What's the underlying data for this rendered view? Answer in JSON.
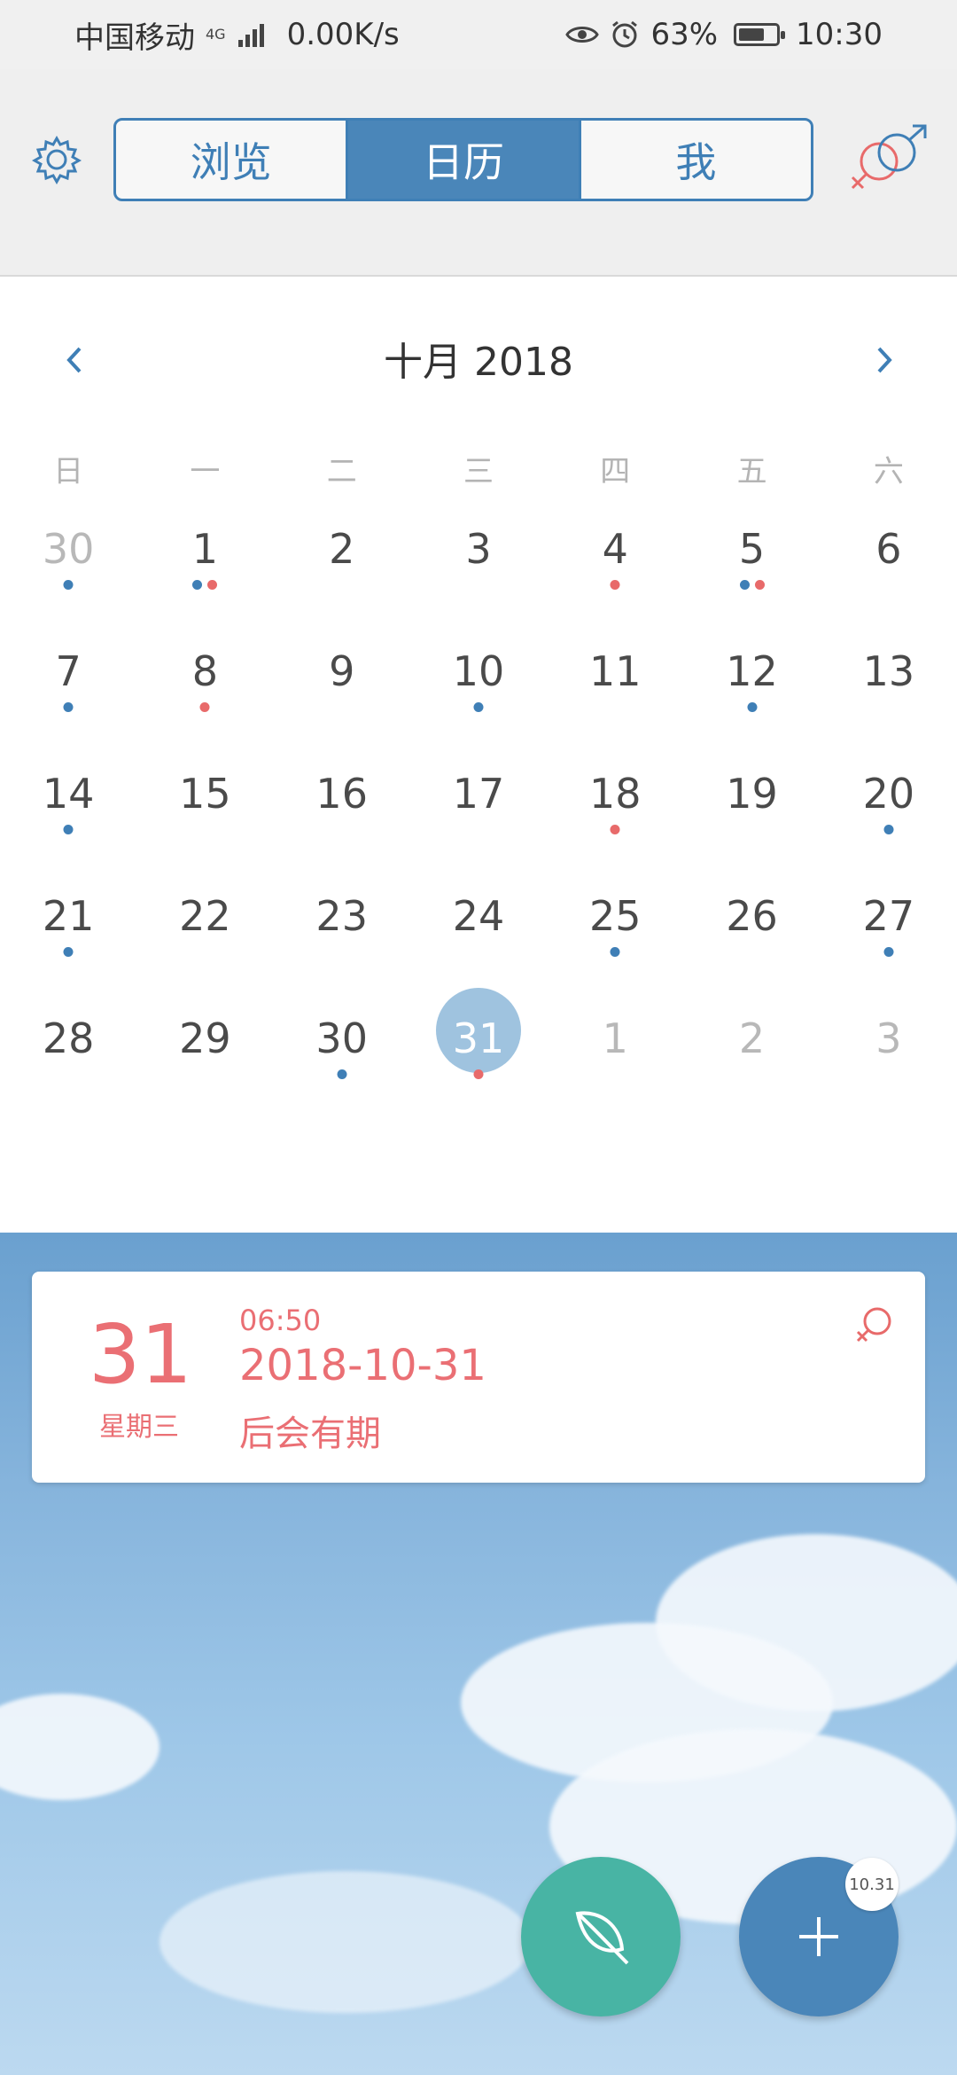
{
  "status_bar": {
    "carrier": "中国移动",
    "network": "4G",
    "speed": "0.00K/s",
    "battery_percent": "63%",
    "time": "10:30",
    "icons": [
      "eye-icon",
      "alarm-icon",
      "battery-icon",
      "signal-icon"
    ]
  },
  "header": {
    "tabs": [
      {
        "label": "浏览"
      },
      {
        "label": "日历"
      },
      {
        "label": "我"
      }
    ],
    "active_tab": "日历",
    "left_icon": "gear-icon",
    "right_icon": "gender-icon",
    "colors": {
      "accent": "#4a86b9",
      "pink": "#e86a6a"
    }
  },
  "calendar": {
    "month_label": "十月 2018",
    "weekdays": [
      "日",
      "一",
      "二",
      "三",
      "四",
      "五",
      "六"
    ],
    "weeks": [
      [
        "30",
        "1",
        "2",
        "3",
        "4",
        "5",
        "6"
      ],
      [
        "7",
        "8",
        "9",
        "10",
        "11",
        "12",
        "13"
      ],
      [
        "14",
        "15",
        "16",
        "17",
        "18",
        "19",
        "20"
      ],
      [
        "21",
        "22",
        "23",
        "24",
        "25",
        "26",
        "27"
      ],
      [
        "28",
        "29",
        "30",
        "31",
        "1",
        "2",
        "3"
      ]
    ],
    "selected_day": "31"
  },
  "event": {
    "day": "31",
    "weekday": "星期三",
    "time": "06:50",
    "date": "2018-10-31",
    "title": "后会有期",
    "icon": "female-symbol-icon"
  },
  "fab": {
    "badge": "10.31",
    "leaf_icon": "leaf-icon",
    "add_icon": "plus-icon"
  }
}
